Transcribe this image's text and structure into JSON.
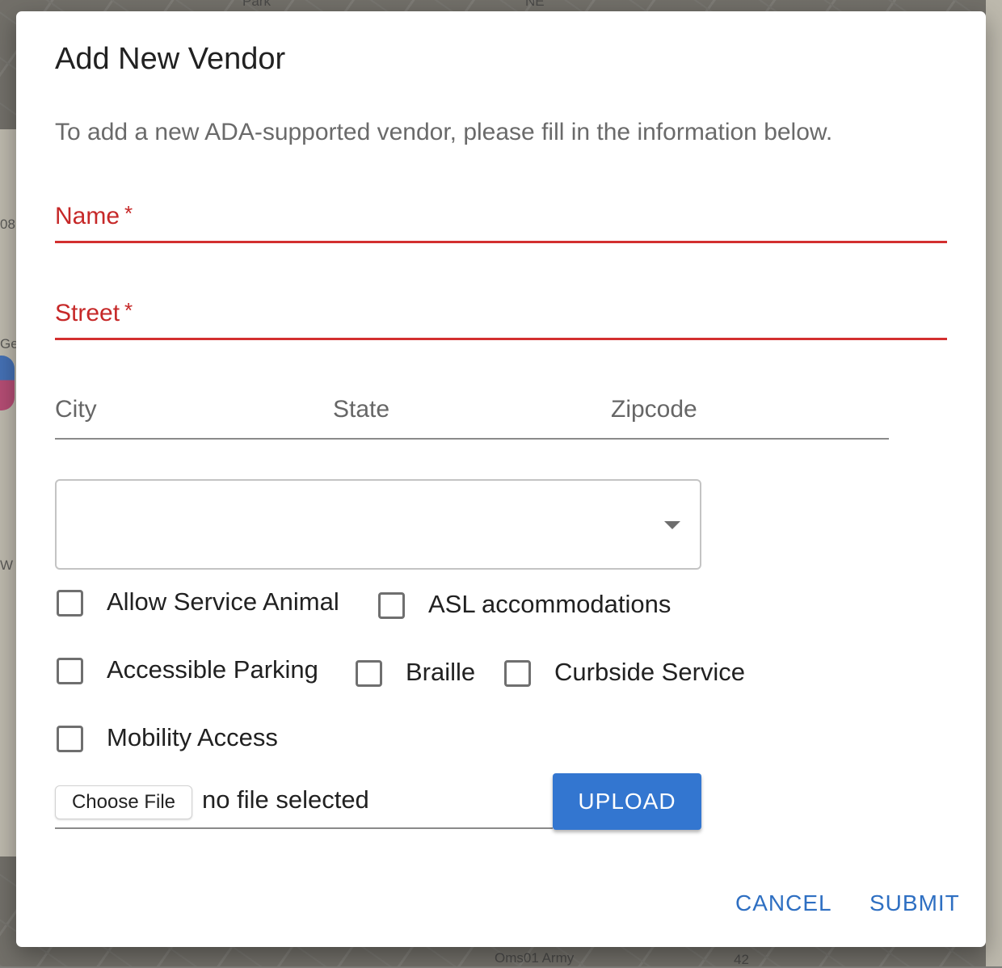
{
  "background": {
    "map_labels": [
      "Park",
      "NE",
      "08",
      "Ge",
      "W",
      "Oms01 Army",
      "42"
    ]
  },
  "dialog": {
    "title": "Add New Vendor",
    "subtitle": "To add a new ADA-supported vendor, please fill in the information below.",
    "fields": {
      "name": {
        "label": "Name",
        "required_mark": "*",
        "value": ""
      },
      "street": {
        "label": "Street",
        "required_mark": "*",
        "value": ""
      },
      "city": {
        "label": "City",
        "value": ""
      },
      "state": {
        "label": "State",
        "value": ""
      },
      "zipcode": {
        "label": "Zipcode",
        "value": ""
      }
    },
    "select": {
      "value": "",
      "icon": "chevron-down-icon"
    },
    "checkboxes": [
      {
        "label": "Allow Service Animal",
        "checked": false
      },
      {
        "label": "ASL accommodations",
        "checked": false
      },
      {
        "label": "Accessible Parking",
        "checked": false
      },
      {
        "label": "Braille",
        "checked": false
      },
      {
        "label": "Curbside Service",
        "checked": false
      },
      {
        "label": "Mobility Access",
        "checked": false
      }
    ],
    "file": {
      "choose_label": "Choose File",
      "status": "no file selected",
      "upload_label": "UPLOAD"
    },
    "actions": {
      "cancel_label": "CANCEL",
      "submit_label": "SUBMIT"
    }
  },
  "colors": {
    "error_red": "#d32f2f",
    "primary_blue": "#3376d0",
    "link_blue": "#2e6fc2"
  }
}
